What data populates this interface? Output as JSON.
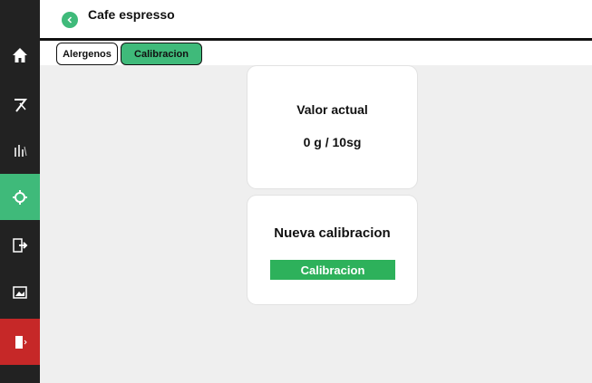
{
  "header": {
    "title": "Cafe espresso",
    "back_icon_glyph": "<"
  },
  "tabs": [
    {
      "label": "Alergenos",
      "active": false
    },
    {
      "label": "Calibracion",
      "active": true
    }
  ],
  "sidebar": {
    "items": [
      {
        "icon": "home-icon",
        "active": false
      },
      {
        "icon": "tools-icon",
        "active": false
      },
      {
        "icon": "bar-chart-icon",
        "active": false
      },
      {
        "icon": "calibration-gear-icon",
        "active": true
      },
      {
        "icon": "login-icon",
        "active": false
      },
      {
        "icon": "image-icon",
        "active": false
      },
      {
        "icon": "exit-door-icon",
        "active": false
      }
    ]
  },
  "current_card": {
    "label": "Valor actual",
    "value": "0 g / 10sg"
  },
  "new_card": {
    "label": "Nueva calibracion",
    "button_label": "Calibracion"
  },
  "colors": {
    "accent_green": "#3fba7a",
    "button_green": "#2db15b",
    "exit_red": "#c62828",
    "sidebar_bg": "#222222",
    "content_bg": "#efefef"
  }
}
